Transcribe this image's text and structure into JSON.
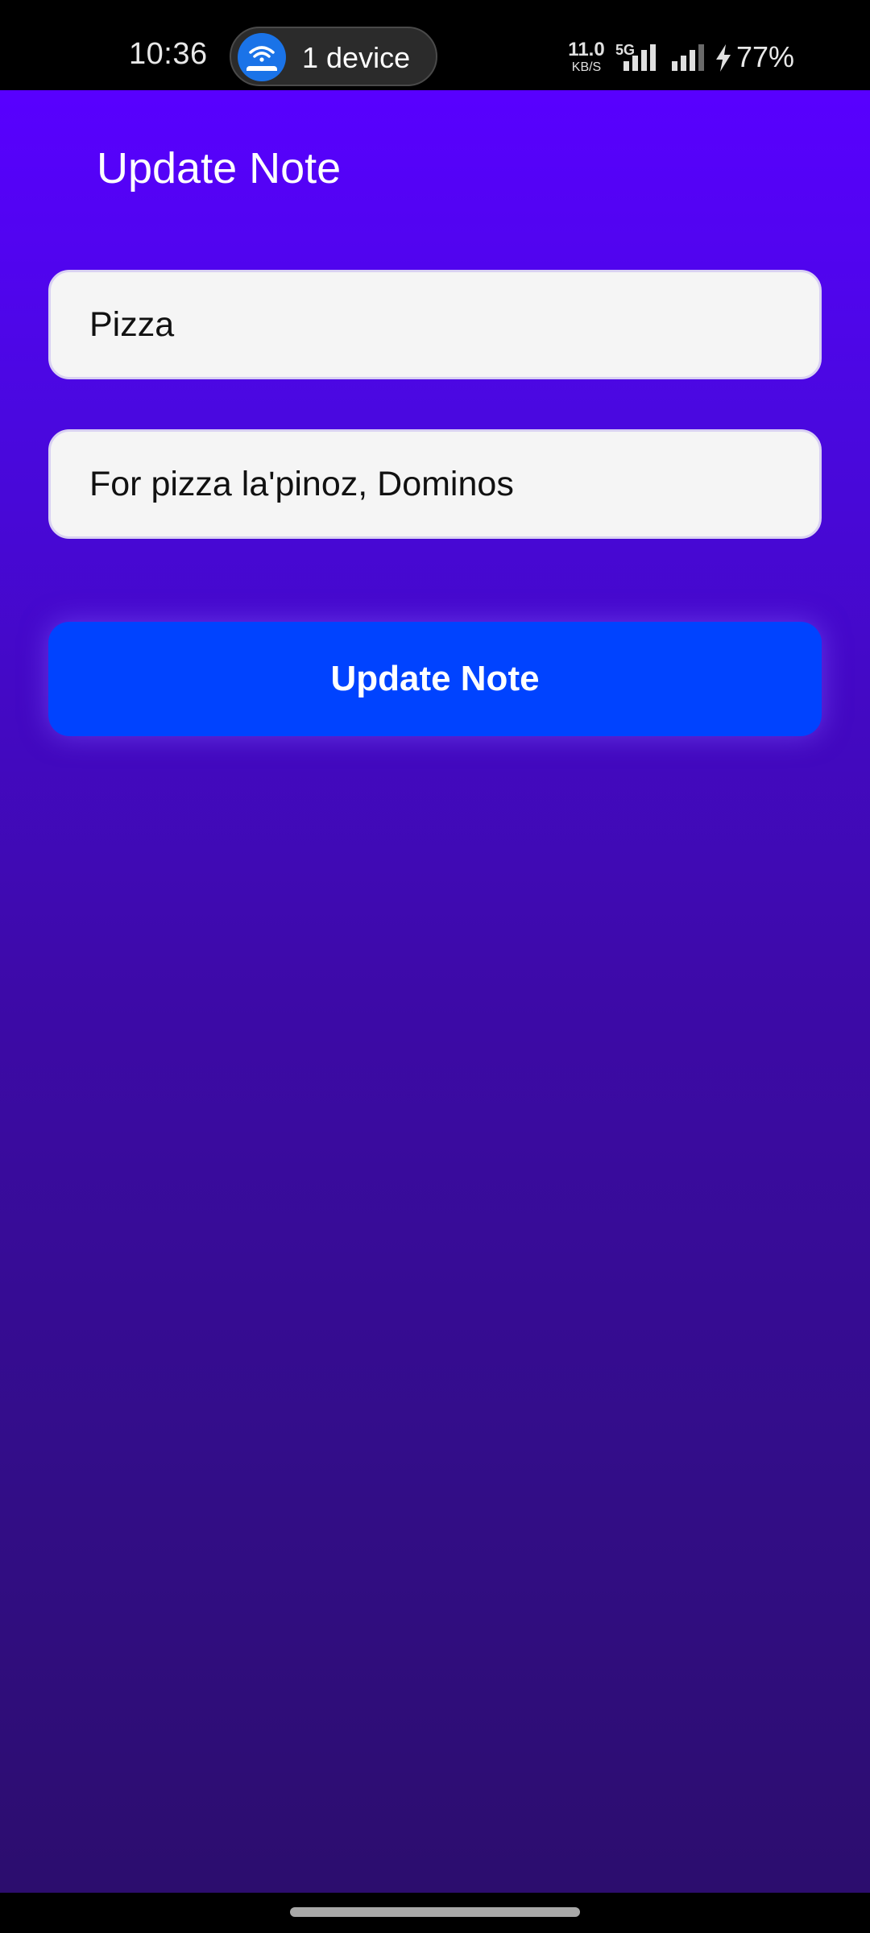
{
  "status_bar": {
    "time": "10:36",
    "hotspot": {
      "icon": "hotspot-router-icon",
      "label": "1 device"
    },
    "network_speed": {
      "value": "11.0",
      "unit": "KB/S"
    },
    "network_type": "5G",
    "battery": {
      "percent": "77%",
      "charging": true
    }
  },
  "screen": {
    "title": "Update Note",
    "fields": {
      "title_value": "Pizza",
      "description_value": "For pizza la'pinoz, Dominos"
    },
    "submit_label": "Update Note"
  },
  "colors": {
    "accent_button": "#0043ff",
    "background_top": "#5800ff",
    "background_bottom": "#2c0d6e"
  }
}
